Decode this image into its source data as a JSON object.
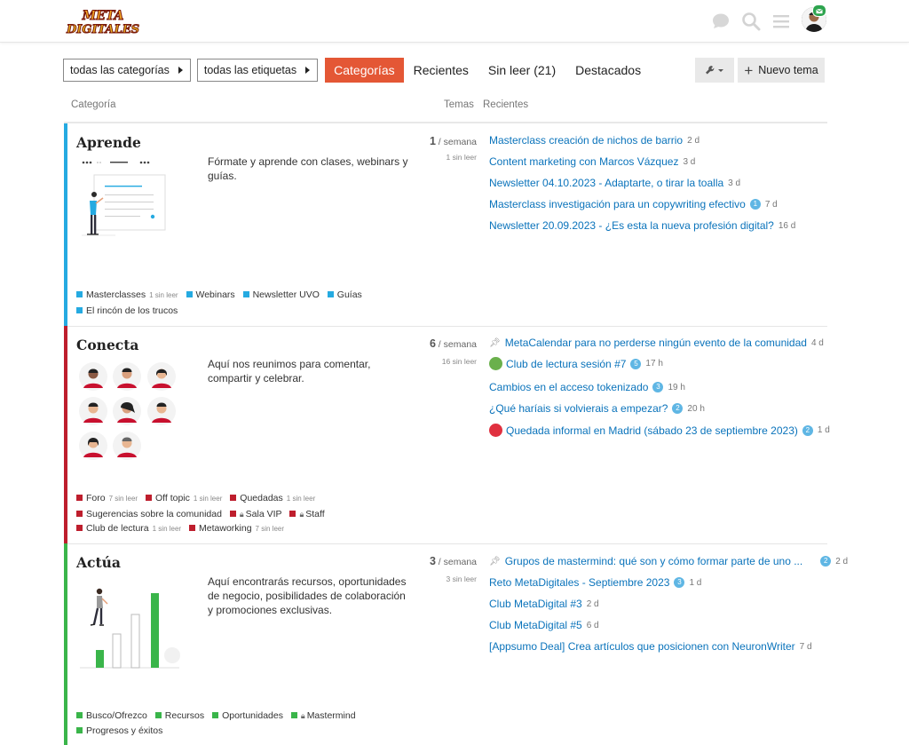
{
  "header": {
    "logo_text": "META DIGITALES",
    "icons": [
      "chat-icon",
      "search-icon",
      "hamburger-icon",
      "user-avatar"
    ]
  },
  "nav": {
    "categories_dd": "todas las categorías",
    "tags_dd": "todas las etiquetas",
    "items": [
      "Categorías",
      "Recientes",
      "Sin leer (21)",
      "Destacados"
    ],
    "active": "Categorías",
    "new_topic": "Nuevo tema"
  },
  "table_head": {
    "category": "Categoría",
    "topics": "Temas",
    "latest": "Recientes"
  },
  "colors": {
    "accent": "#e45735",
    "aprende": "#25aae1",
    "conecta": "#be1e2d",
    "actua": "#3ab54a",
    "link": "#0a73bb"
  },
  "categories": [
    {
      "name": "Aprende",
      "description": "Fórmate y aprende con clases, webinars y guías.",
      "topics_num": "1",
      "topics_unit": " / semana",
      "unread": "1 sin leer",
      "subcategories": [
        {
          "name": "Masterclasses",
          "unread": "1 sin leer",
          "locked": false
        },
        {
          "name": "Webinars",
          "unread": "",
          "locked": false
        },
        {
          "name": "Newsletter UVO",
          "unread": "",
          "locked": false
        },
        {
          "name": "Guías",
          "unread": "",
          "locked": false
        },
        {
          "name": "El rincón de los trucos",
          "unread": "",
          "locked": false
        }
      ],
      "latest": [
        {
          "title": "Masterclass creación de nichos de barrio",
          "count": "",
          "age": "2 d",
          "pinned": false
        },
        {
          "title": "Content marketing con Marcos Vázquez",
          "count": "",
          "age": "3 d",
          "pinned": false
        },
        {
          "title": "Newsletter 04.10.2023 - Adaptarte, o tirar la toalla",
          "count": "",
          "age": "3 d",
          "pinned": false
        },
        {
          "title": "Masterclass investigación para un copywriting efectivo",
          "count": "1",
          "age": "7 d",
          "pinned": false
        },
        {
          "title": "Newsletter 20.09.2023 - ¿Es esta la nueva profesión digital?",
          "count": "",
          "age": "16 d",
          "pinned": false
        }
      ]
    },
    {
      "name": "Conecta",
      "description": "Aquí nos reunimos para comentar, compartir y celebrar.",
      "topics_num": "6",
      "topics_unit": " / semana",
      "unread": "16 sin leer",
      "subcategories": [
        {
          "name": "Foro",
          "unread": "7 sin leer",
          "locked": false
        },
        {
          "name": "Off topic",
          "unread": "1 sin leer",
          "locked": false
        },
        {
          "name": "Quedadas",
          "unread": "1 sin leer",
          "locked": false
        },
        {
          "name": "Sugerencias sobre la comunidad",
          "unread": "",
          "locked": false
        },
        {
          "name": "Sala VIP",
          "unread": "",
          "locked": true
        },
        {
          "name": "Staff",
          "unread": "",
          "locked": true
        },
        {
          "name": "Club de lectura",
          "unread": "1 sin leer",
          "locked": false
        },
        {
          "name": "Metaworking",
          "unread": "7 sin leer",
          "locked": false
        }
      ],
      "latest": [
        {
          "title": "MetaCalendar para no perderse ningún evento de la comunidad",
          "count": "",
          "age": "4 d",
          "pinned": true,
          "dot": ""
        },
        {
          "title": "Club de lectura sesión #7",
          "count": "5",
          "age": "17 h",
          "pinned": false,
          "dot": "#6ab04c"
        },
        {
          "title": "Cambios en el acceso tokenizado",
          "count": "3",
          "age": "19 h",
          "pinned": false,
          "dot": ""
        },
        {
          "title": "¿Qué haríais si volvierais a empezar?",
          "count": "2",
          "age": "20 h",
          "pinned": false,
          "dot": ""
        },
        {
          "title": "Quedada informal en Madrid (sábado 23 de septiembre 2023)",
          "count": "2",
          "age": "1 d",
          "pinned": false,
          "dot": "#e0303f"
        }
      ]
    },
    {
      "name": "Actúa",
      "description": "Aquí encontrarás recursos, oportunidades de negocio, posibilidades de colaboración y promociones exclusivas.",
      "topics_num": "3",
      "topics_unit": " / semana",
      "unread": "3 sin leer",
      "subcategories": [
        {
          "name": "Busco/Ofrezco",
          "unread": "",
          "locked": false
        },
        {
          "name": "Recursos",
          "unread": "",
          "locked": false
        },
        {
          "name": "Oportunidades",
          "unread": "",
          "locked": false
        },
        {
          "name": "Mastermind",
          "unread": "",
          "locked": true
        },
        {
          "name": "Progresos y éxitos",
          "unread": "",
          "locked": false
        }
      ],
      "latest": [
        {
          "title": "Grupos de mastermind: qué son y cómo formar parte de uno ...",
          "count": "2",
          "age": "2 d",
          "pinned": true
        },
        {
          "title": "Reto MetaDigitales - Septiembre 2023",
          "count": "3",
          "age": "1 d",
          "pinned": false
        },
        {
          "title": "Club MetaDigital #3",
          "count": "",
          "age": "2 d",
          "pinned": false
        },
        {
          "title": "Club MetaDigital #5",
          "count": "",
          "age": "6 d",
          "pinned": false
        },
        {
          "title": "[Appsumo Deal] Crea artículos que posicionen con NeuronWriter",
          "count": "",
          "age": "7 d",
          "pinned": false
        }
      ]
    }
  ]
}
